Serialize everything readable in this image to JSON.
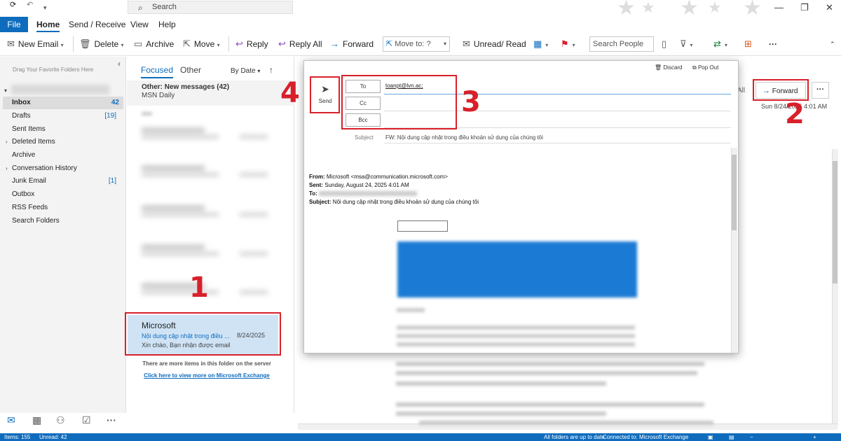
{
  "titlebar": {
    "search_placeholder": "Search"
  },
  "menu": {
    "file": "File",
    "home": "Home",
    "send_receive": "Send / Receive",
    "view": "View",
    "help": "Help"
  },
  "ribbon": {
    "new_email": "New Email",
    "delete": "Delete",
    "archive": "Archive",
    "move": "Move",
    "reply": "Reply",
    "reply_all": "Reply All",
    "forward": "Forward",
    "move_to": "Move to: ?",
    "unread_read": "Unread/ Read",
    "search_people": "Search People"
  },
  "nav": {
    "fav_hint": "Drag Your Favorite Folders Here",
    "folders": [
      {
        "label": "Inbox",
        "count": "42"
      },
      {
        "label": "Drafts",
        "count": "[19]"
      },
      {
        "label": "Sent Items",
        "count": ""
      },
      {
        "label": "Deleted Items",
        "count": ""
      },
      {
        "label": "Archive",
        "count": ""
      },
      {
        "label": "Conversation History",
        "count": ""
      },
      {
        "label": "Junk Email",
        "count": "[1]"
      },
      {
        "label": "Outbox",
        "count": ""
      },
      {
        "label": "RSS Feeds",
        "count": ""
      },
      {
        "label": "Search Folders",
        "count": ""
      }
    ]
  },
  "list": {
    "tab_focused": "Focused",
    "tab_other": "Other",
    "sort": "By Date",
    "other_title": "Other: New messages (42)",
    "other_sub": "MSN Daily",
    "selected": {
      "from": "Microsoft",
      "subject": "Nội dung cập nhật trong điều ...",
      "date": "8/24/2025",
      "preview": "Xin chào, Bạn nhận được email"
    },
    "more_items": "There are more items in this folder on the server",
    "exchange_link": "Click here to view more on Microsoft Exchange"
  },
  "reading": {
    "all": "All",
    "forward": "Forward",
    "date": "Sun 8/24/2025 4:01 AM"
  },
  "compose": {
    "discard": "Discard",
    "popout": "Pop Out",
    "send": "Send",
    "to_label": "To",
    "cc_label": "Cc",
    "bcc_label": "Bcc",
    "to_value": "toanpt@lvn.ac;",
    "subject_label": "Subject",
    "subject_value": "FW: Nội dung cập nhật trong điều khoản sử dụng của chúng tôi",
    "from_label": "From:",
    "from_value": "Microsoft <msa@communication.microsoft.com>",
    "sent_label": "Sent:",
    "sent_value": "Sunday, August 24, 2025 4:01 AM",
    "to2_label": "To:",
    "subject2_label": "Subject:",
    "subject2_value": "Nội dung cập nhật trong điều khoản sử dụng của chúng tôi"
  },
  "annotations": {
    "n1": "1",
    "n2": "2",
    "n3": "3",
    "n4": "4"
  },
  "status": {
    "items": "Items: 155",
    "unread": "Unread: 42",
    "uptodate": "All folders are up to date.",
    "connected": "Connected to: Microsoft Exchange"
  },
  "colors": {
    "accent": "#0f6cbd",
    "highlight": "#d8202a"
  }
}
